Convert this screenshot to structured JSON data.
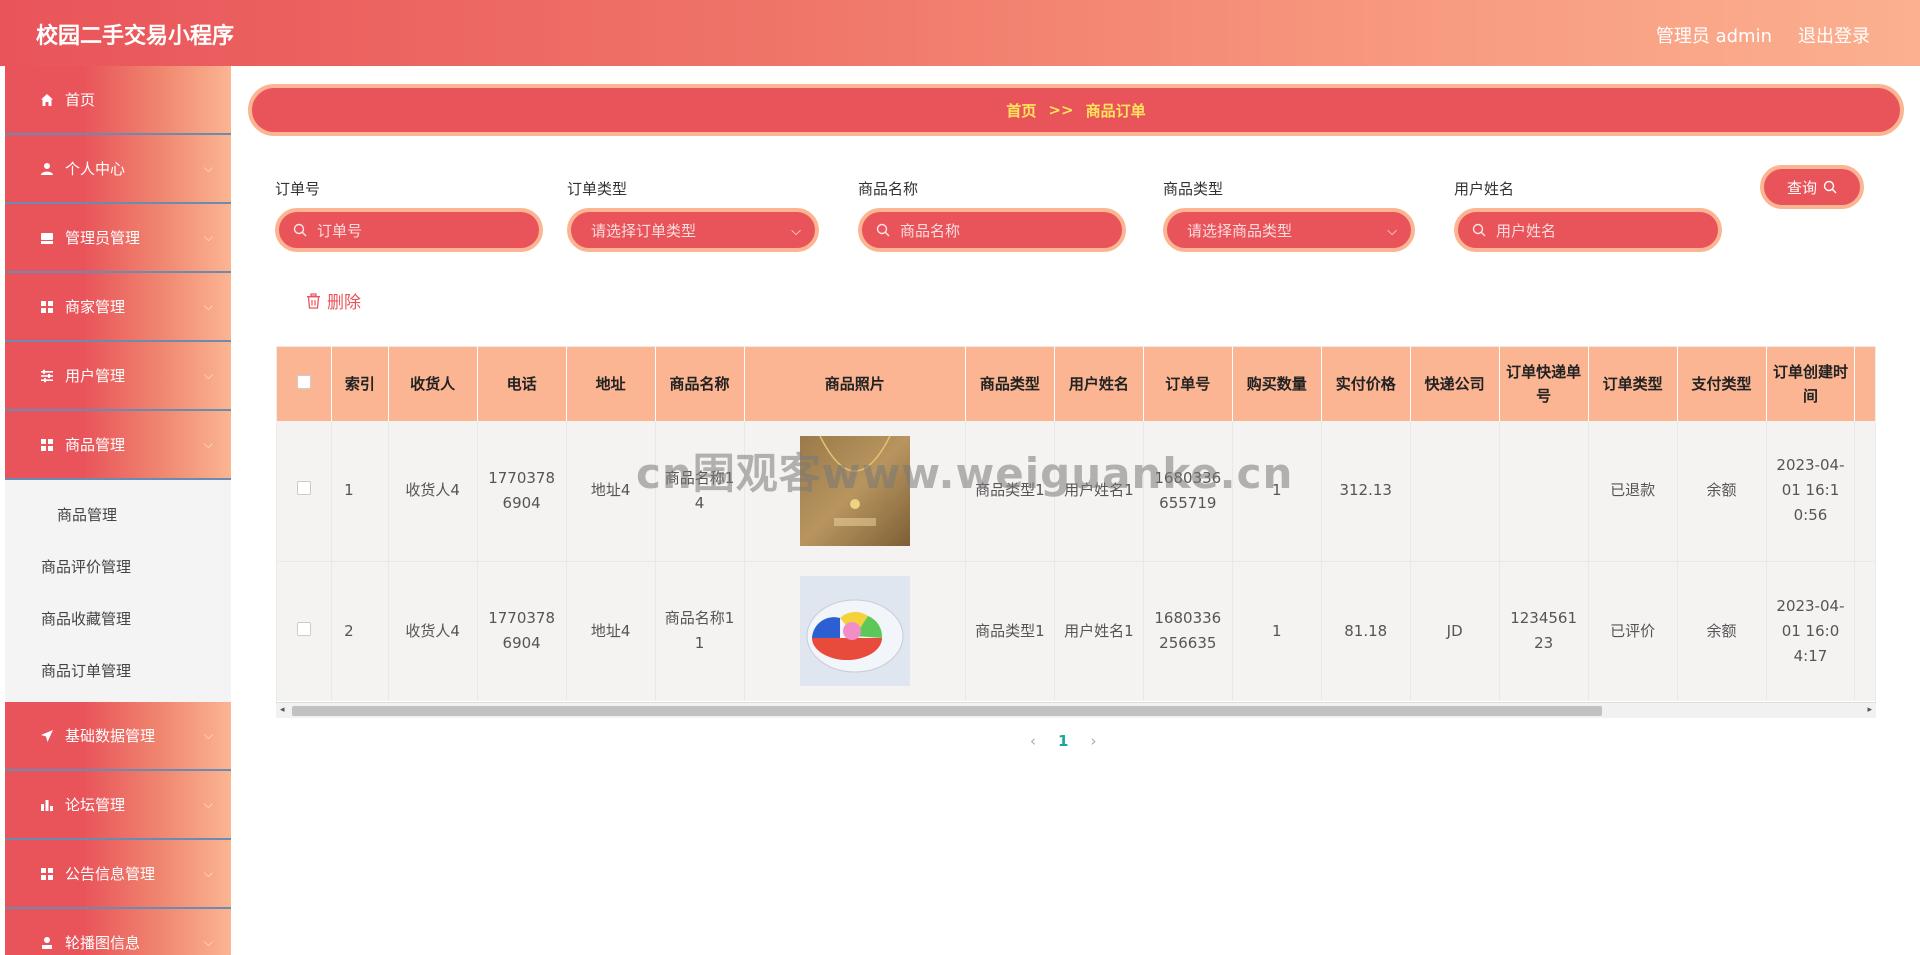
{
  "header": {
    "app_title": "校园二手交易小程序",
    "admin_label": "管理员 admin",
    "logout_label": "退出登录"
  },
  "sidebar": {
    "items": [
      {
        "label": "首页",
        "icon": "home-icon",
        "has_chevron": false
      },
      {
        "label": "个人中心",
        "icon": "user-icon",
        "has_chevron": true
      },
      {
        "label": "管理员管理",
        "icon": "archive-icon",
        "has_chevron": true
      },
      {
        "label": "商家管理",
        "icon": "grid-icon",
        "has_chevron": true
      },
      {
        "label": "用户管理",
        "icon": "sliders-icon",
        "has_chevron": true
      },
      {
        "label": "商品管理",
        "icon": "grid-icon",
        "has_chevron": true
      }
    ],
    "submenu": [
      "商品管理",
      "商品评价管理",
      "商品收藏管理",
      "商品订单管理"
    ],
    "items_after": [
      {
        "label": "基础数据管理",
        "icon": "send-icon",
        "has_chevron": true
      },
      {
        "label": "论坛管理",
        "icon": "bar-chart-icon",
        "has_chevron": true
      },
      {
        "label": "公告信息管理",
        "icon": "grid-icon",
        "has_chevron": true
      },
      {
        "label": "轮播图信息",
        "icon": "person-icon",
        "has_chevron": true
      }
    ]
  },
  "breadcrumb": {
    "home": "首页",
    "separator": ">>",
    "current": "商品订单"
  },
  "filters": {
    "order_no_label": "订单号",
    "order_no_placeholder": "订单号",
    "order_type_label": "订单类型",
    "order_type_placeholder": "请选择订单类型",
    "goods_name_label": "商品名称",
    "goods_name_placeholder": "商品名称",
    "goods_type_label": "商品类型",
    "goods_type_placeholder": "请选择商品类型",
    "username_label": "用户姓名",
    "username_placeholder": "用户姓名",
    "query_label": "查询"
  },
  "actions": {
    "delete_label": "删除"
  },
  "table": {
    "columns": [
      "索引",
      "收货人",
      "电话",
      "地址",
      "商品名称",
      "商品照片",
      "商品类型",
      "用户姓名",
      "订单号",
      "购买数量",
      "实付价格",
      "快递公司",
      "订单快递单号",
      "订单类型",
      "支付类型",
      "订单创建时间"
    ],
    "rows": [
      {
        "index": "1",
        "receiver": "收货人4",
        "phone": "17703786904",
        "address": "地址4",
        "goods_name": "商品名称14",
        "photo": "gold-necklace",
        "goods_type": "商品类型1",
        "username": "用户姓名1",
        "order_no": "1680336655719",
        "quantity": "1",
        "price": "312.13",
        "courier": "",
        "tracking_no": "",
        "order_type": "已退款",
        "pay_type": "余额",
        "created": "2023-04-01 16:10:56"
      },
      {
        "index": "2",
        "receiver": "收货人4",
        "phone": "17703786904",
        "address": "地址4",
        "goods_name": "商品名称11",
        "photo": "color-tray",
        "goods_type": "商品类型1",
        "username": "用户姓名1",
        "order_no": "1680336256635",
        "quantity": "1",
        "price": "81.18",
        "courier": "JD",
        "tracking_no": "123456123",
        "order_type": "已评价",
        "pay_type": "余额",
        "created": "2023-04-01 16:04:17"
      }
    ]
  },
  "pagination": {
    "prev": "‹",
    "current": "1",
    "next": "›"
  },
  "watermark": "cn围观客www.weiguanke.cn",
  "colors": {
    "accent": "#e9545a",
    "accent_light": "#fbb592",
    "breadcrumb_text": "#ffe45c",
    "pager_active": "#14a8a0"
  }
}
